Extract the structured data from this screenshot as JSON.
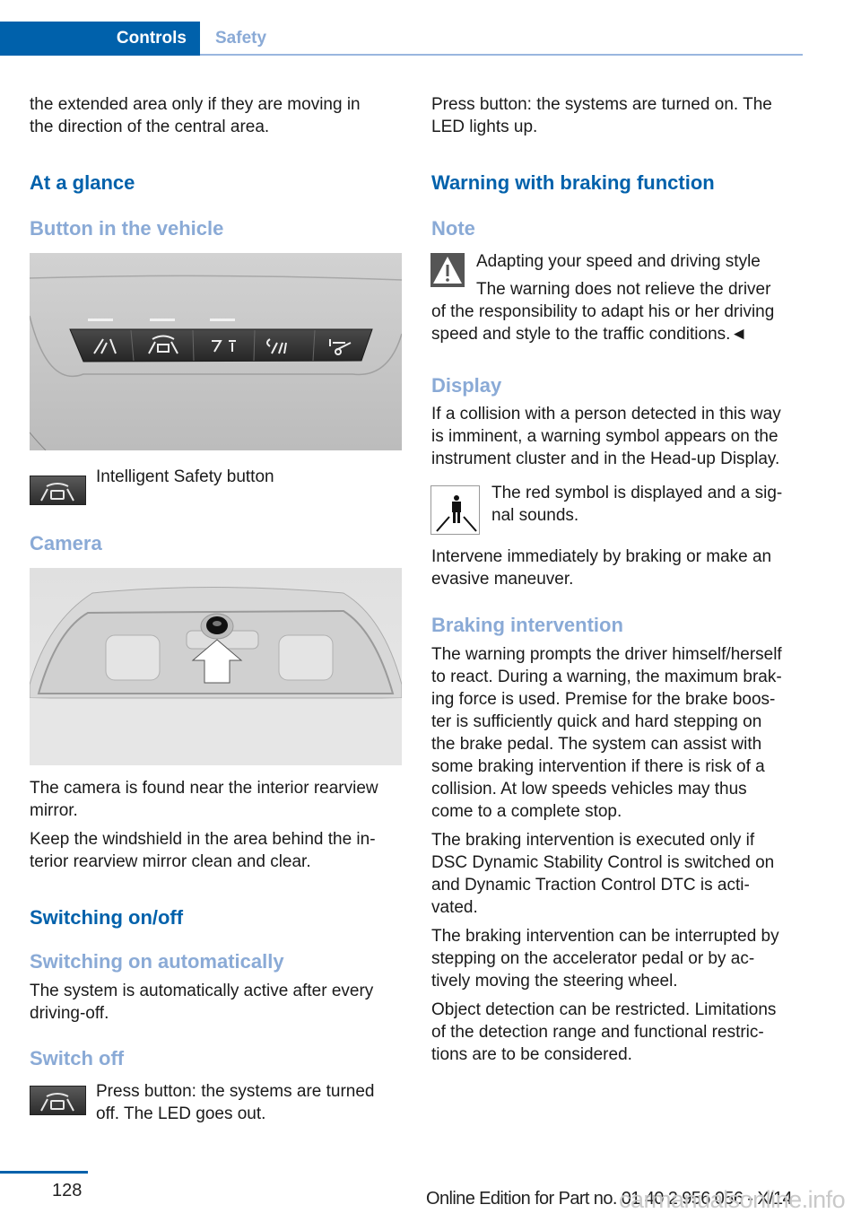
{
  "header": {
    "section_active": "Controls",
    "section": "Safety"
  },
  "left": {
    "intro": "the extended area only if they are moving in\nthe direction of the central area.",
    "h_at_a_glance": "At a glance",
    "h_button": "Button in the vehicle",
    "button_figure": {
      "caption": "Intelligent Safety button",
      "buttons": [
        "pedestrian-warning",
        "intelligent-safety",
        "lane-departure",
        "lane-change",
        "park-assist"
      ]
    },
    "h_camera": "Camera",
    "camera_p1": "The camera is found near the interior rearview\nmirror.",
    "camera_p2": "Keep the windshield in the area behind the in-\nterior rearview mirror clean and clear.",
    "h_switching": "Switching on/off",
    "h_auto": "Switching on automatically",
    "auto_p": "The system is automatically active after every\ndriving-off.",
    "h_switch_off": "Switch off",
    "switch_off_p": "Press button: the systems are turned\noff. The LED goes out."
  },
  "right": {
    "press_on_p": "Press button: the systems are turned on. The\nLED lights up.",
    "h_warning": "Warning with braking function",
    "h_note": "Note",
    "note_title": "Adapting your speed and driving style",
    "note_body_first": "The warning does not relieve the driver",
    "note_body_rest": "of the responsibility to adapt his or her driving\nspeed and style to the traffic conditions.◄",
    "h_display": "Display",
    "display_p": "If a collision with a person detected in this way\nis imminent, a warning symbol appears on the\ninstrument cluster and in the Head-up Display.",
    "symbol_p": "The red symbol is displayed and a sig-\nnal sounds.",
    "intervene_p": "Intervene immediately by braking or make an\nevasive maneuver.",
    "h_braking": "Braking intervention",
    "braking_p1": "The warning prompts the driver himself/herself\nto react. During a warning, the maximum brak-\ning force is used. Premise for the brake boos-\nter is sufficiently quick and hard stepping on\nthe brake pedal. The system can assist with\nsome braking intervention if there is risk of a\ncollision. At low speeds vehicles may thus\ncome to a complete stop.",
    "braking_p2": "The braking intervention is executed only if\nDSC Dynamic Stability Control is switched on\nand Dynamic Traction Control DTC is acti-\nvated.",
    "braking_p3": "The braking intervention can be interrupted by\nstepping on the accelerator pedal or by ac-\ntively moving the steering wheel.",
    "braking_p4": "Object detection can be restricted. Limitations\nof the detection range and functional restric-\ntions are to be considered."
  },
  "footer": {
    "page_number": "128",
    "edition": "Online Edition for Part no. 01 40 2 956 056 - X/14",
    "watermark": "carmanualsonline.info"
  },
  "colors": {
    "brand_blue": "#0061ab",
    "sub_heading": "#8aaad6"
  }
}
